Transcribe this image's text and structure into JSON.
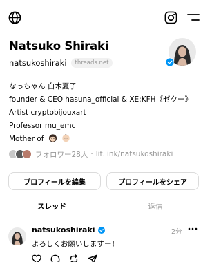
{
  "header": {
    "globe_icon": "globe-icon",
    "instagram_icon": "instagram-icon",
    "menu_icon": "menu-icon"
  },
  "profile": {
    "name": "Natsuko Shiraki",
    "username": "natsukoshiraki",
    "domain_badge": "threads.net",
    "verified_icon": "verified-badge-icon",
    "bio": [
      "なっちゃん 白木夏子",
      "founder & CEO hasuna_official & XE:KFH《ゼクー》",
      "Artist cryptobijouxart",
      "Professor mu_emc"
    ],
    "bio_last": "Mother of",
    "bio_emojis": [
      "girl-emoji",
      "baby-emoji"
    ],
    "followers_text": "フォロワー28人",
    "separator": "·",
    "link": "lit.link/natsukoshiraki"
  },
  "buttons": {
    "edit_label": "プロフィールを編集",
    "share_label": "プロフィールをシェア"
  },
  "tabs": [
    {
      "label": "スレッド",
      "active": true
    },
    {
      "label": "返信",
      "active": false
    }
  ],
  "post": {
    "author": "natsukoshiraki",
    "time": "2分",
    "text": "よろしくお願いしますー！",
    "actions": [
      "heart-icon",
      "comment-icon",
      "repost-icon",
      "send-icon"
    ]
  },
  "colors": {
    "verified": "#0095f6",
    "secondary_text": "#999999",
    "border": "#dbdbdb"
  }
}
